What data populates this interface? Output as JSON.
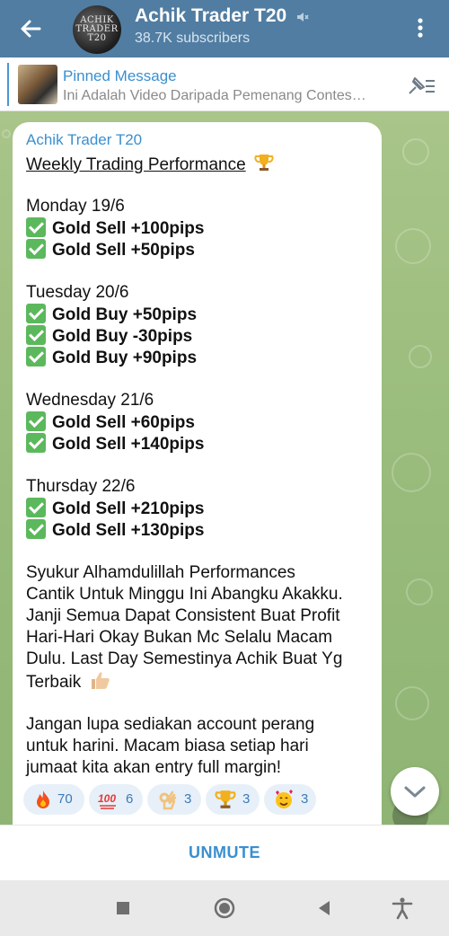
{
  "header": {
    "channel_title": "Achik Trader T20",
    "subscribers": "38.7K subscribers",
    "avatar_text": "ACHIK TRADER T20",
    "icons": [
      "back-arrow-icon",
      "mute-icon",
      "more-vert-icon"
    ]
  },
  "pinned": {
    "title": "Pinned Message",
    "text": "Ini Adalah Video Daripada Pemenang Contes…",
    "icons": [
      "pin-list-icon"
    ]
  },
  "message": {
    "author": "Achik Trader T20",
    "heading": "Weekly Trading Performance",
    "days": [
      {
        "day": "Monday 19/6",
        "trades": [
          "Gold Sell +100pips",
          "Gold Sell +50pips"
        ]
      },
      {
        "day": "Tuesday 20/6",
        "trades": [
          "Gold Buy +50pips",
          "Gold Buy -30pips",
          "Gold Buy +90pips"
        ]
      },
      {
        "day": "Wednesday 21/6",
        "trades": [
          "Gold Sell +60pips",
          "Gold Sell +140pips"
        ]
      },
      {
        "day": "Thursday 22/6",
        "trades": [
          "Gold Sell +210pips",
          "Gold Sell +130pips"
        ]
      }
    ],
    "paragraph1": [
      "Syukur Alhamdulillah Performances",
      "Cantik Untuk Minggu Ini Abangku Akakku.",
      "Janji Semua Dapat Consistent Buat Profit",
      "Hari-Hari Okay Bukan Mc Selalu Macam",
      "Dulu. Last Day Semestinya Achik Buat Yg",
      "Terbaik"
    ],
    "paragraph2": [
      "Jangan lupa sediakan account perang",
      "untuk harini. Macam biasa setiap hari",
      "jumaat kita akan entry full margin!"
    ]
  },
  "reactions": [
    {
      "emoji": "fire-icon",
      "count": "70"
    },
    {
      "emoji": "hundred-points-icon",
      "count": "6"
    },
    {
      "emoji": "ok-hand-icon",
      "count": "3"
    },
    {
      "emoji": "trophy-icon",
      "count": "3"
    },
    {
      "emoji": "smiling-hearts-icon",
      "count": "3"
    }
  ],
  "bottom": {
    "unmute_label": "UNMUTE"
  },
  "system_nav": [
    "square-icon",
    "home-circle-icon",
    "back-triangle-icon",
    "accessibility-icon"
  ],
  "colors": {
    "header": "#517da2",
    "accent": "#3a8fd0",
    "check": "#5cb85c",
    "reaction_bg": "#e7f0f8"
  }
}
